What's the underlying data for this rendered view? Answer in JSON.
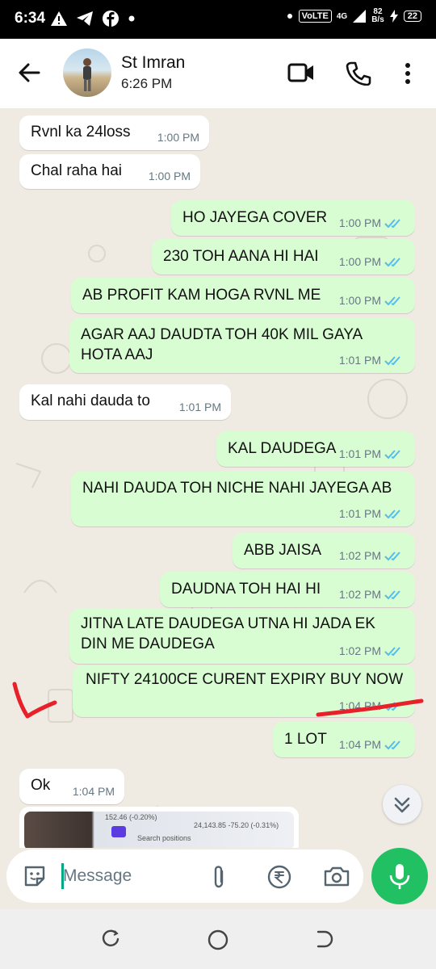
{
  "status_bar": {
    "time": "6:34",
    "volte": "VoLTE",
    "network_type": "4G",
    "speed_value": "82",
    "speed_unit": "B/s",
    "battery": "22"
  },
  "header": {
    "contact_name": "St Imran",
    "last_seen": "6:26 PM"
  },
  "messages": [
    {
      "dir": "in",
      "text": "Rvnl ka 24loss",
      "time": "1:00 PM"
    },
    {
      "dir": "in",
      "text": "Chal raha hai",
      "time": "1:00 PM"
    },
    {
      "dir": "out",
      "text": "HO JAYEGA COVER",
      "time": "1:00 PM"
    },
    {
      "dir": "out",
      "text": "230 TOH AANA HI HAI",
      "time": "1:00 PM"
    },
    {
      "dir": "out",
      "text": "AB PROFIT KAM HOGA RVNL ME",
      "time": "1:00 PM"
    },
    {
      "dir": "out",
      "text": "AGAR AAJ DAUDTA TOH 40K MIL GAYA HOTA AAJ",
      "time": "1:01 PM"
    },
    {
      "dir": "in",
      "text": "Kal nahi dauda to",
      "time": "1:01 PM"
    },
    {
      "dir": "out",
      "text": "KAL DAUDEGA",
      "time": "1:01 PM"
    },
    {
      "dir": "out",
      "text": "NAHI DAUDA TOH NICHE NAHI JAYEGA AB",
      "time": "1:01 PM"
    },
    {
      "dir": "out",
      "text": "ABB JAISA",
      "time": "1:02 PM"
    },
    {
      "dir": "out",
      "text": "DAUDNA TOH HAI HI",
      "time": "1:02 PM"
    },
    {
      "dir": "out",
      "text": "JITNA LATE DAUDEGA UTNA HI JADA EK DIN ME DAUDEGA",
      "time": "1:02 PM"
    },
    {
      "dir": "out",
      "text": "NIFTY 24100CE CURENT EXPIRY BUY NOW",
      "time": "1:04 PM"
    },
    {
      "dir": "out",
      "text": "1 LOT",
      "time": "1:04 PM"
    },
    {
      "dir": "in",
      "text": "Ok",
      "time": "1:04 PM"
    }
  ],
  "image_preview_text": [
    "152.46 (-0.20%)",
    "24,143.85 -75.20 (-0.31%)",
    "Search positions"
  ],
  "input": {
    "placeholder": "Message"
  },
  "colors": {
    "outgoing_bubble": "#d9fdd3",
    "incoming_bubble": "#ffffff",
    "chat_bg": "#efeae2",
    "accent": "#21c063",
    "read_ticks": "#53bdeb",
    "annotation": "#e8202a"
  }
}
